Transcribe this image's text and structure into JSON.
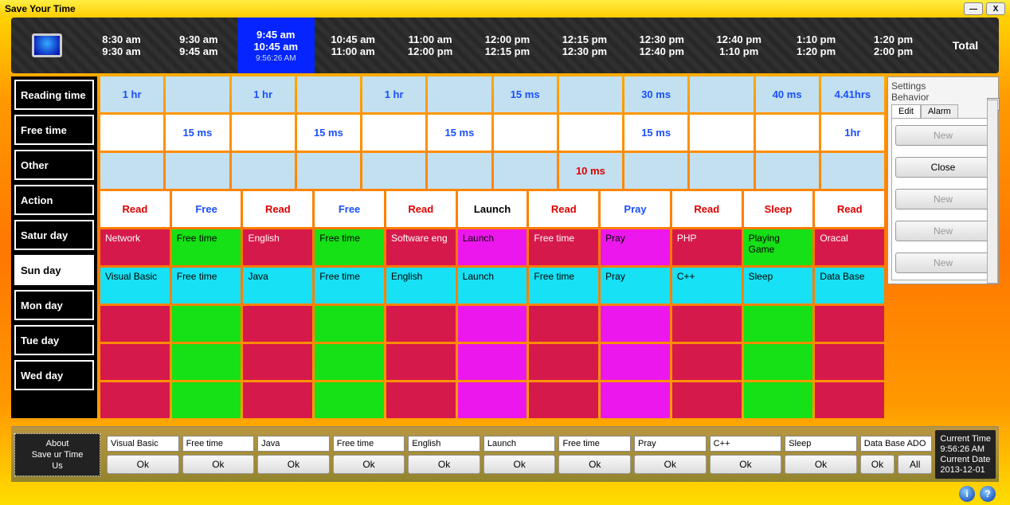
{
  "title": "Save Your Time",
  "time_header": {
    "slots": [
      {
        "start": "8:30 am",
        "end": "9:30 am"
      },
      {
        "start": "9:30 am",
        "end": "9:45 am"
      },
      {
        "start": "9:45 am",
        "end": "10:45 am",
        "active": true,
        "now": "9:56:26 AM"
      },
      {
        "start": "10:45 am",
        "end": "11:00 am"
      },
      {
        "start": "11:00 am",
        "end": "12:00 pm"
      },
      {
        "start": "12:00 pm",
        "end": "12:15 pm"
      },
      {
        "start": "12:15 pm",
        "end": "12:30 pm"
      },
      {
        "start": "12:30 pm",
        "end": "12:40 pm"
      },
      {
        "start": "12:40 pm",
        "end": "1:10 pm"
      },
      {
        "start": "1:10 pm",
        "end": "1:20 pm"
      },
      {
        "start": "1:20 pm",
        "end": "2:00 pm"
      }
    ],
    "total_label": "Total"
  },
  "left_labels": [
    "Reading time",
    "Free time",
    "Other",
    "Action",
    "Satur day",
    "Sun day",
    "Mon day",
    "Tue day",
    "Wed day"
  ],
  "active_day_index": 5,
  "reading_row": [
    "1 hr",
    "",
    "1 hr",
    "",
    "1 hr",
    "",
    "15 ms",
    "",
    "30 ms",
    "",
    "40 ms",
    "4.41hrs"
  ],
  "free_row": [
    "",
    "15 ms",
    "",
    "15 ms",
    "",
    "15 ms",
    "",
    "",
    "15 ms",
    "",
    "",
    "1hr"
  ],
  "other_row": [
    "",
    "",
    "",
    "",
    "",
    "",
    "",
    "10 ms",
    "",
    "",
    "",
    ""
  ],
  "action_row": [
    {
      "t": "Read",
      "c": "act-red"
    },
    {
      "t": "Free",
      "c": "act-blue"
    },
    {
      "t": "Read",
      "c": "act-red"
    },
    {
      "t": "Free",
      "c": "act-blue"
    },
    {
      "t": "Read",
      "c": "act-red"
    },
    {
      "t": "Launch",
      "c": "act-black"
    },
    {
      "t": "Read",
      "c": "act-red"
    },
    {
      "t": "Pray",
      "c": "act-blue"
    },
    {
      "t": "Read",
      "c": "act-red"
    },
    {
      "t": "Sleep",
      "c": "act-red"
    },
    {
      "t": "Read",
      "c": "act-red"
    }
  ],
  "day_rows": [
    {
      "cells": [
        {
          "t": "Network",
          "c": "c-crimson"
        },
        {
          "t": "Free time",
          "c": "c-green"
        },
        {
          "t": "English",
          "c": "c-crimson"
        },
        {
          "t": "Free time",
          "c": "c-green"
        },
        {
          "t": "Software eng",
          "c": "c-crimson"
        },
        {
          "t": "Launch",
          "c": "c-magenta"
        },
        {
          "t": "Free time",
          "c": "c-crimson"
        },
        {
          "t": "Pray",
          "c": "c-magenta"
        },
        {
          "t": "PHP",
          "c": "c-crimson"
        },
        {
          "t": "Playing Game",
          "c": "c-green"
        },
        {
          "t": "Oracal",
          "c": "c-crimson"
        }
      ]
    },
    {
      "cells": [
        {
          "t": "Visual Basic",
          "c": "c-cyan"
        },
        {
          "t": "Free time",
          "c": "c-cyan"
        },
        {
          "t": "Java",
          "c": "c-cyan"
        },
        {
          "t": "Free time",
          "c": "c-cyan"
        },
        {
          "t": "English",
          "c": "c-cyan"
        },
        {
          "t": "Launch",
          "c": "c-cyan"
        },
        {
          "t": "Free time",
          "c": "c-cyan"
        },
        {
          "t": "Pray",
          "c": "c-cyan"
        },
        {
          "t": "C++",
          "c": "c-cyan"
        },
        {
          "t": "Sleep",
          "c": "c-cyan"
        },
        {
          "t": "Data Base",
          "c": "c-cyan"
        }
      ]
    },
    {
      "cells": [
        {
          "t": "",
          "c": "c-crimson"
        },
        {
          "t": "",
          "c": "c-green"
        },
        {
          "t": "",
          "c": "c-crimson"
        },
        {
          "t": "",
          "c": "c-green"
        },
        {
          "t": "",
          "c": "c-crimson"
        },
        {
          "t": "",
          "c": "c-magenta"
        },
        {
          "t": "",
          "c": "c-crimson"
        },
        {
          "t": "",
          "c": "c-magenta"
        },
        {
          "t": "",
          "c": "c-crimson"
        },
        {
          "t": "",
          "c": "c-green"
        },
        {
          "t": "",
          "c": "c-crimson"
        }
      ]
    },
    {
      "cells": [
        {
          "t": "",
          "c": "c-crimson"
        },
        {
          "t": "",
          "c": "c-green"
        },
        {
          "t": "",
          "c": "c-crimson"
        },
        {
          "t": "",
          "c": "c-green"
        },
        {
          "t": "",
          "c": "c-crimson"
        },
        {
          "t": "",
          "c": "c-magenta"
        },
        {
          "t": "",
          "c": "c-crimson"
        },
        {
          "t": "",
          "c": "c-magenta"
        },
        {
          "t": "",
          "c": "c-crimson"
        },
        {
          "t": "",
          "c": "c-green"
        },
        {
          "t": "",
          "c": "c-crimson"
        }
      ]
    },
    {
      "cells": [
        {
          "t": "",
          "c": "c-crimson"
        },
        {
          "t": "",
          "c": "c-green"
        },
        {
          "t": "",
          "c": "c-crimson"
        },
        {
          "t": "",
          "c": "c-green"
        },
        {
          "t": "",
          "c": "c-crimson"
        },
        {
          "t": "",
          "c": "c-magenta"
        },
        {
          "t": "",
          "c": "c-crimson"
        },
        {
          "t": "",
          "c": "c-magenta"
        },
        {
          "t": "",
          "c": "c-crimson"
        },
        {
          "t": "",
          "c": "c-green"
        },
        {
          "t": "",
          "c": "c-crimson"
        }
      ]
    }
  ],
  "inputs": [
    "Visual Basic",
    "Free time",
    "Java",
    "Free time",
    "English",
    "Launch",
    "Free time",
    "Pray",
    "C++",
    "Sleep",
    "Data Base ADO"
  ],
  "ok_label": "Ok",
  "all_label": "All",
  "about": {
    "l1": "About",
    "l2": "Save ur Time",
    "l3": "Us"
  },
  "settings": {
    "title": "Settings",
    "group": "Behavior",
    "tabs": [
      "Edit",
      "Alarm"
    ],
    "active_tab": 0,
    "buttons": [
      "New",
      "Close",
      "New",
      "New",
      "New"
    ],
    "enabled": [
      false,
      true,
      false,
      false,
      false
    ]
  },
  "status": {
    "l1": "Current Time",
    "l2": "9:56:26 AM",
    "l3": "Current Date",
    "l4": "2013-12-01"
  }
}
